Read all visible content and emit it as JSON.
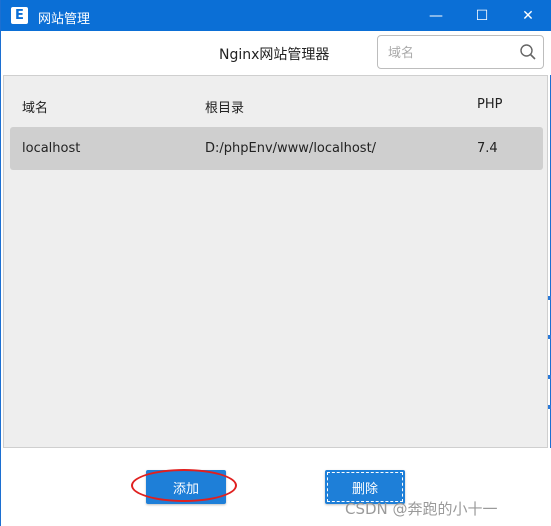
{
  "window": {
    "title": "网站管理",
    "app_icon_letter": "E",
    "controls": {
      "minimize": "—",
      "maximize": "☐",
      "close": "✕"
    }
  },
  "header": {
    "title": "Nginx网站管理器",
    "search": {
      "placeholder": "域名",
      "value": ""
    }
  },
  "table": {
    "columns": [
      "域名",
      "根目录",
      "PHP"
    ],
    "rows": [
      {
        "domain": "localhost",
        "root": "D:/phpEnv/www/localhost/",
        "php": "7.4"
      }
    ]
  },
  "footer": {
    "add_label": "添加",
    "delete_label": "删除"
  },
  "watermark": "CSDN @奔跑的小十一",
  "colors": {
    "titlebar": "#0b6fd6",
    "button": "#1e7fd8",
    "annotation": "#e0201f",
    "row_selected": "#cfcfcf",
    "content_bg": "#eeeeee"
  }
}
